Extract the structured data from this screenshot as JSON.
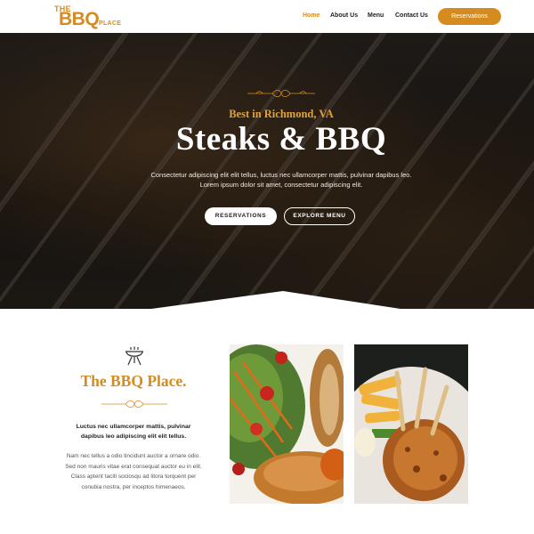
{
  "header": {
    "logo": {
      "the": "THE",
      "bbq": "BBQ",
      "place": "PLACE"
    },
    "nav": [
      {
        "label": "Home"
      },
      {
        "label": "About Us"
      },
      {
        "label": "Menu"
      },
      {
        "label": "Contact Us"
      }
    ],
    "reservations_label": "Reservations"
  },
  "hero": {
    "kicker": "Best in Richmond, VA",
    "title": "Steaks & BBQ",
    "text": "Consectetur adipiscing elit elit tellus, luctus nec ullamcorper mattis, pulvinar dapibus leo. Lorem ipsum dolor sit amet, consectetur adipiscing elit.",
    "buttons": {
      "reservations": "RESERVATIONS",
      "explore": "EXPLORE MENU"
    }
  },
  "about": {
    "title": "The BBQ Place.",
    "lead": "Luctus nec ullamcorper mattis, pulvinar dapibus leo adipiscing elit elit tellus.",
    "body": "Nam nec tellus a odio tincidunt auctor a ornare odio. Sed non mauris vitae erat consequat auctor eu in elit. Class aptent taciti sociosqu ad litora torquent per conubia nostra, per inceptos himenaeos."
  },
  "colors": {
    "accent": "#d68b1f",
    "dark": "#222222",
    "hero_overlay": "#1c1714"
  },
  "icons": {
    "grill": "grill-icon",
    "flourish": "flourish-ornament"
  }
}
